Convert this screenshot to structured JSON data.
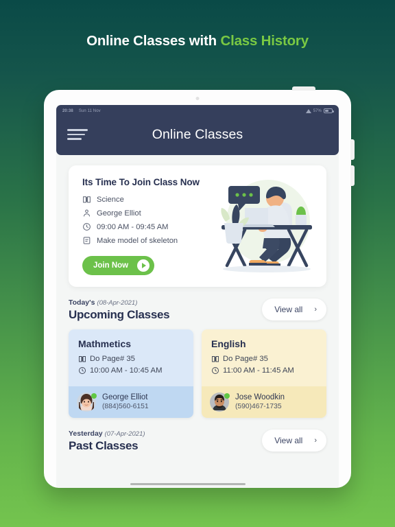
{
  "promo": {
    "headline_plain": "Online Classes with ",
    "headline_accent": "Class History",
    "accent_color": "#7ac943"
  },
  "device": {
    "statusbar": {
      "time": "20:38",
      "date": "Sun 11 Nov",
      "battery_percent": "57%",
      "wifi_icon": "wifi-icon",
      "battery_icon": "battery-icon"
    }
  },
  "navbar": {
    "menu_icon": "hamburger-menu-icon",
    "title": "Online Classes"
  },
  "hero": {
    "title": "Its Time To Join Class Now",
    "rows": [
      {
        "icon": "book-icon",
        "text": "Science"
      },
      {
        "icon": "person-icon",
        "text": "George Elliot"
      },
      {
        "icon": "clock-icon",
        "text": "09:00 AM   - 09:45 AM"
      },
      {
        "icon": "note-icon",
        "text": "Make model of skeleton"
      }
    ],
    "join_label": "Join Now",
    "join_icon": "play-icon",
    "join_color": "#6cc14a",
    "illustration": "man-at-desk-with-laptop-illustration"
  },
  "upcoming": {
    "eyebrow_label": "Today's",
    "eyebrow_date": "(08-Apr-2021)",
    "title": "Upcoming Classes",
    "view_all_label": "View all",
    "view_all_icon": "chevron-right-icon",
    "classes": [
      {
        "subject": "Mathmetics",
        "task_icon": "book-icon",
        "task": "Do Page# 35",
        "time_icon": "clock-icon",
        "time": "10:00 AM - 10:45 AM",
        "teacher": "George Elliot",
        "phone": "(884)560-6151",
        "avatar": "female-teacher-avatar",
        "status": "online",
        "theme": "blue",
        "top_color": "#dbe8f8",
        "foot_color": "#bfd8f2"
      },
      {
        "subject": "English",
        "task_icon": "book-icon",
        "task": "Do Page# 35",
        "time_icon": "clock-icon",
        "time": "11:00 AM - 11:45 AM",
        "teacher": "Jose Woodkin",
        "phone": "(590)467-1735",
        "avatar": "male-teacher-avatar",
        "status": "online",
        "theme": "yellow",
        "top_color": "#faf1d2",
        "foot_color": "#f6e9ba"
      }
    ]
  },
  "past": {
    "eyebrow_label": "Yesterday",
    "eyebrow_date": "(07-Apr-2021)",
    "title": "Past Classes",
    "view_all_label": "View all",
    "view_all_icon": "chevron-right-icon"
  }
}
